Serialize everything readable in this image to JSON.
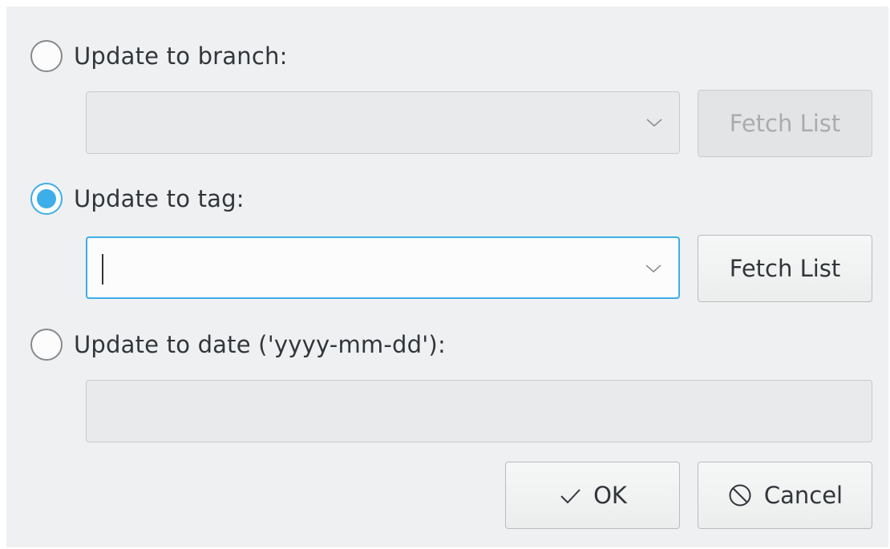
{
  "options": {
    "branch": {
      "label": "Update to branch:",
      "checked": false,
      "value": "",
      "fetch_label": "Fetch List",
      "enabled": false
    },
    "tag": {
      "label": "Update to tag:",
      "checked": true,
      "value": "",
      "fetch_label": "Fetch List",
      "enabled": true
    },
    "date": {
      "label": "Update to date ('yyyy-mm-dd'):",
      "checked": false,
      "value": "",
      "enabled": false
    }
  },
  "buttons": {
    "ok_label": "OK",
    "ok_icon": "checkmark-icon",
    "cancel_label": "Cancel",
    "cancel_icon": "cancel-icon"
  },
  "colors": {
    "accent": "#3daee9",
    "window_bg": "#eff0f1",
    "text": "#31363b"
  }
}
